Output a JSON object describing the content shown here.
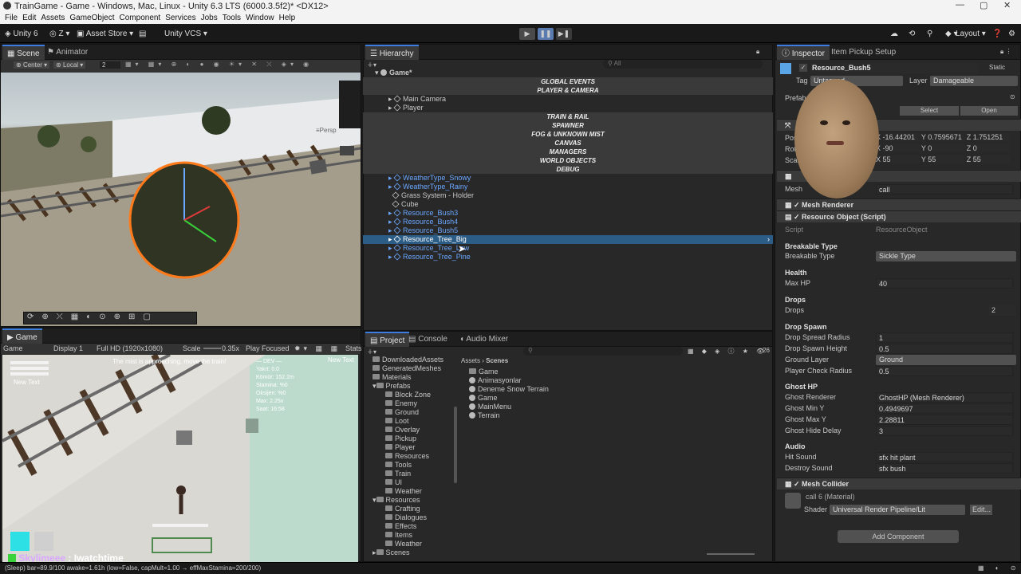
{
  "window": {
    "title": "TrainGame - Game - Windows, Mac, Linux - Unity 6.3 LTS (6000.3.5f2)* <DX12>",
    "min": "—",
    "max": "▢",
    "close": "✕"
  },
  "menu": [
    "File",
    "Edit",
    "Assets",
    "GameObject",
    "Component",
    "Services",
    "Jobs",
    "Tools",
    "Window",
    "Help"
  ],
  "toolbar": {
    "account": "Unity 6",
    "user": "Z",
    "asset_store": "Asset Store",
    "vcs": "Unity VCS",
    "layout": "Layout",
    "play_icon": "play-icon",
    "pause_icon": "pause-icon",
    "step_icon": "step-icon"
  },
  "scene": {
    "tabs": [
      "Scene",
      "Animator"
    ],
    "pivot": "Center",
    "space": "Local",
    "grid_snap": "2",
    "persp": "≡Persp"
  },
  "game": {
    "tab": "Game",
    "mode": "Game",
    "display": "Display 1",
    "resolution": "Full HD (1920x1080)",
    "scale_label": "Scale",
    "scale": "0.35x",
    "play_mode": "Play Focused",
    "stats": "Stats",
    "new_text_left": "New Text",
    "new_text_right": "New Text",
    "mist": "The mist is approaching, move the train!",
    "dev_lines": [
      "— DEV —",
      "Yakıt: 0.0",
      "Kömür: 152.2m",
      "Stamina: %0",
      "Oksijen: %0",
      "Max: 2.25x",
      "Saat: 16:58"
    ]
  },
  "status": {
    "text": "(Sleep) bar=89.9/100 awake=1.61h (low=False, capMult=1.00 → effMaxStamina=200/200)"
  },
  "stream": {
    "user": "Skylimeee",
    "message": ": Iwatchtime"
  },
  "hierarchy": {
    "tab": "Hierarchy",
    "search_placeholder": "All",
    "root": "Game*",
    "items": [
      {
        "label": "GLOBAL EVENTS",
        "type": "sep"
      },
      {
        "label": "PLAYER & CAMERA",
        "type": "sep"
      },
      {
        "label": "Main Camera",
        "type": "obj"
      },
      {
        "label": "Player",
        "type": "obj"
      },
      {
        "label": "",
        "type": "sep"
      },
      {
        "label": "TRAIN & RAIL",
        "type": "sep"
      },
      {
        "label": "SPAWNER",
        "type": "sep"
      },
      {
        "label": "FOG & UNKNOWN MIST",
        "type": "sep"
      },
      {
        "label": "CANVAS",
        "type": "sep"
      },
      {
        "label": "MANAGERS",
        "type": "sep"
      },
      {
        "label": "WORLD OBJECTS",
        "type": "sep"
      },
      {
        "label": "DEBUG",
        "type": "sep"
      },
      {
        "label": "WeatherType_Snowy",
        "type": "prefab"
      },
      {
        "label": "WeatherType_Rainy",
        "type": "prefab"
      },
      {
        "label": "Grass System - Holder",
        "type": "obj"
      },
      {
        "label": "Cube",
        "type": "obj"
      },
      {
        "label": "Resource_Bush3",
        "type": "prefab"
      },
      {
        "label": "Resource_Bush4",
        "type": "prefab"
      },
      {
        "label": "Resource_Bush5",
        "type": "prefab"
      },
      {
        "label": "Resource_Tree_Big",
        "type": "selected"
      },
      {
        "label": "Resource_Tree_Low",
        "type": "prefab"
      },
      {
        "label": "Resource_Tree_Pine",
        "type": "prefab"
      }
    ]
  },
  "project": {
    "tabs": [
      "Project",
      "Console",
      "Audio Mixer"
    ],
    "breadcrumb": [
      "Assets",
      "Scenes"
    ],
    "count": "26",
    "tree": [
      "DownloadedAssets",
      "GeneratedMeshes",
      "Materials",
      "Prefabs",
      "Block Zone",
      "Enemy",
      "Ground",
      "Loot",
      "Overlay",
      "Pickup",
      "Player",
      "Resources",
      "Tools",
      "Train",
      "UI",
      "Weather",
      "Resources",
      "Crafting",
      "Dialogues",
      "Effects",
      "Items",
      "Weather",
      "Scenes"
    ],
    "assets": [
      "Game",
      "Animasyonlar",
      "Deneme Snow Terrain",
      "Game",
      "MainMenu",
      "Terrain"
    ]
  },
  "inspector": {
    "tabs": [
      "Inspector",
      "Item Pickup Setup"
    ],
    "name": "Resource_Bush5",
    "static": "Static",
    "tag_label": "Tag",
    "tag": "Untagged",
    "layer_label": "Layer",
    "layer": "Damageable",
    "prefab_label": "Prefab",
    "select": "Select",
    "open": "Open",
    "pos_label": "Position",
    "pos": {
      "x": "-16.44201",
      "y": "0.7595671",
      "z": "1.751251"
    },
    "rot_label": "Rotation",
    "rot": {
      "x": "-90",
      "y": "0",
      "z": "0"
    },
    "scale_label": "Scale",
    "scale": {
      "x": "55",
      "y": "55",
      "z": "55"
    },
    "mesh_label": "Mesh",
    "mesh": "call",
    "mesh_renderer": "Mesh Renderer",
    "resource_object": "Resource Object (Script)",
    "script_label": "Script",
    "script": "ResourceObject",
    "breakable_section": "Breakable Type",
    "breakable_label": "Breakable Type",
    "breakable": "Sickle Type",
    "health_section": "Health",
    "maxhp_label": "Max HP",
    "maxhp": "40",
    "drops_section": "Drops",
    "drops_label": "Drops",
    "drops": "2",
    "dropspawn_section": "Drop Spawn",
    "spread_label": "Drop Spread Radius",
    "spread": "1",
    "height_label": "Drop Spawn Height",
    "height": "0.5",
    "ground_label": "Ground Layer",
    "ground": "Ground",
    "player_check_label": "Player Check Radius",
    "player_check": "0.5",
    "ghost_section": "Ghost HP",
    "ghost_renderer_label": "Ghost Renderer",
    "ghost_renderer": "GhostHP (Mesh Renderer)",
    "ghost_min_label": "Ghost Min Y",
    "ghost_min": "0.4949697",
    "ghost_max_label": "Ghost Max Y",
    "ghost_max": "2.28811",
    "ghost_hide_label": "Ghost Hide Delay",
    "ghost_hide": "3",
    "audio_section": "Audio",
    "hit_label": "Hit Sound",
    "hit": "sfx hit plant",
    "destroy_label": "Destroy Sound",
    "destroy": "sfx bush",
    "mesh_collider": "Mesh Collider",
    "material": "call 6 (Material)",
    "shader_label": "Shader",
    "shader": "Universal Render Pipeline/Lit",
    "edit": "Edit...",
    "add_component": "Add Component"
  }
}
